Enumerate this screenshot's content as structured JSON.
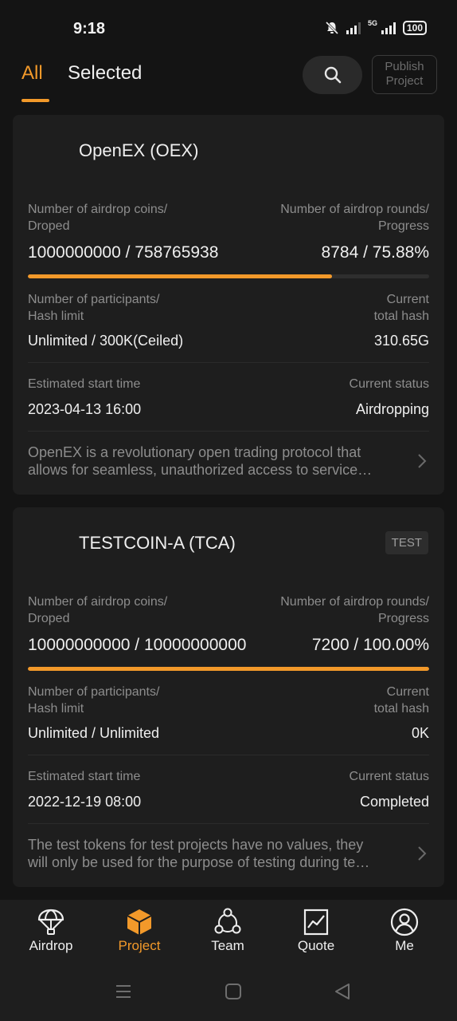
{
  "status_bar": {
    "time": "9:18",
    "network": "5G",
    "battery": "100"
  },
  "header": {
    "tabs": [
      {
        "label": "All",
        "active": true
      },
      {
        "label": "Selected",
        "active": false
      }
    ],
    "search_icon": "search-icon",
    "publish_label_line1": "Publish",
    "publish_label_line2": "Project"
  },
  "accent_color": "#f2992a",
  "projects": [
    {
      "title": "OpenEX (OEX)",
      "tag": "",
      "coins_label_1": "Number of airdrop coins/",
      "coins_label_2": "Droped",
      "coins_value": "1000000000 / 758765938",
      "rounds_label_1": "Number of airdrop rounds/",
      "rounds_label_2": "Progress",
      "rounds_value": "8784 / 75.88%",
      "progress_percent": 75.88,
      "participants_label_1": "Number of participants/",
      "participants_label_2": "Hash limit",
      "participants_value": "Unlimited / 300K(Ceiled)",
      "hash_label_1": "Current",
      "hash_label_2": "total hash",
      "hash_value": "310.65G",
      "start_label": "Estimated start time",
      "start_value": "2023-04-13 16:00",
      "status_label": "Current status",
      "status_value": "Airdropping",
      "desc_line1": "OpenEX is a revolutionary open trading protocol that",
      "desc_line2": "allows for seamless, unauthorized access to service…"
    },
    {
      "title": "TESTCOIN-A (TCA)",
      "tag": "TEST",
      "coins_label_1": "Number of airdrop coins/",
      "coins_label_2": "Droped",
      "coins_value": "10000000000 / 10000000000",
      "rounds_label_1": "Number of airdrop rounds/",
      "rounds_label_2": "Progress",
      "rounds_value": "7200 / 100.00%",
      "progress_percent": 100,
      "participants_label_1": "Number of participants/",
      "participants_label_2": "Hash limit",
      "participants_value": "Unlimited / Unlimited",
      "hash_label_1": "Current",
      "hash_label_2": "total hash",
      "hash_value": "0K",
      "start_label": "Estimated start time",
      "start_value": "2022-12-19 08:00",
      "status_label": "Current status",
      "status_value": "Completed",
      "desc_line1": "The test tokens for test projects have no values, they",
      "desc_line2": "will only be used for the purpose of testing during te…"
    }
  ],
  "bottom_nav": [
    {
      "label": "Airdrop",
      "icon": "parachute-icon",
      "active": false
    },
    {
      "label": "Project",
      "icon": "cube-icon",
      "active": true
    },
    {
      "label": "Team",
      "icon": "team-icon",
      "active": false
    },
    {
      "label": "Quote",
      "icon": "chart-icon",
      "active": false
    },
    {
      "label": "Me",
      "icon": "user-icon",
      "active": false
    }
  ]
}
